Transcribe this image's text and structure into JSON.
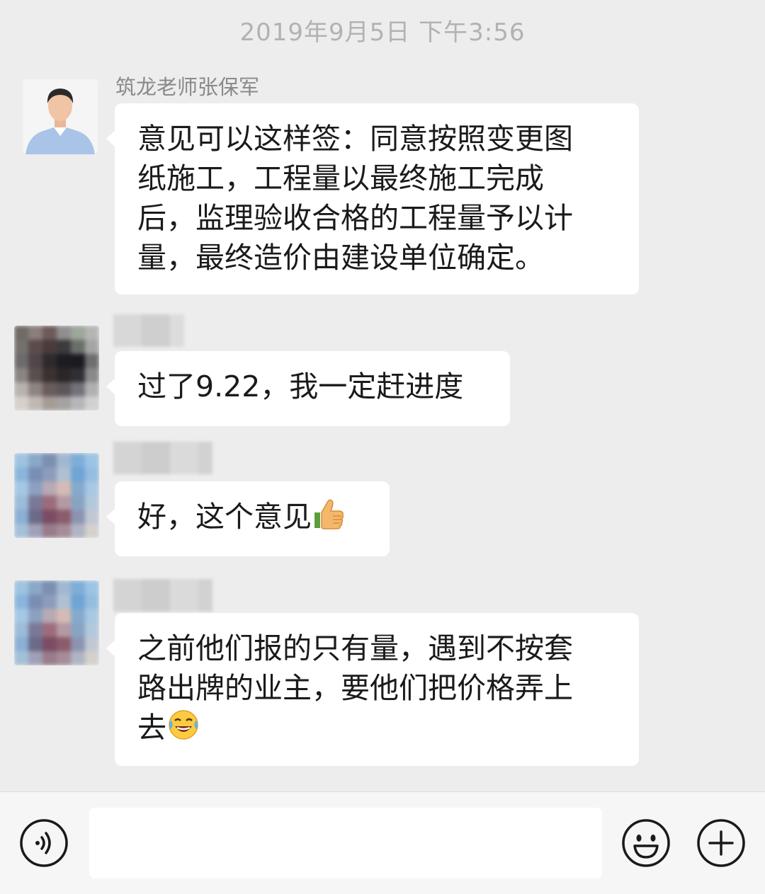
{
  "timestamp": "2019年9月5日 下午3:56",
  "messages": [
    {
      "sender": "筑龙老师张保军",
      "lines": [
        "意见可以这样签：同意按照变更图",
        "纸施工，工程量以最终施工完成",
        "后，监理验收合格的工程量予以计",
        "量，最终造价由建设单位确定。"
      ]
    },
    {
      "sender": "",
      "lines": [
        "过了9.22，我一定赶进度"
      ]
    },
    {
      "sender": "",
      "lines": [
        "好，这个意见"
      ],
      "emoji": "thumbs-up-emoji"
    },
    {
      "sender": "",
      "lines": [
        "之前他们报的只有量，遇到不按套",
        "路出牌的业主，要他们把价格弄上",
        "去"
      ],
      "emoji": "laughing-tears-emoji"
    }
  ],
  "input_bar": {
    "voice_icon": "voice-icon",
    "input_value": "",
    "emoji_icon": "smiley-face-icon",
    "more_icon": "plus-circle-icon"
  },
  "colors": {
    "background": "#ededed",
    "bubble": "#ffffff",
    "timestamp_text": "#b2b2b2",
    "sender_text": "#8a8a8a",
    "message_text": "#1a1a1a"
  }
}
